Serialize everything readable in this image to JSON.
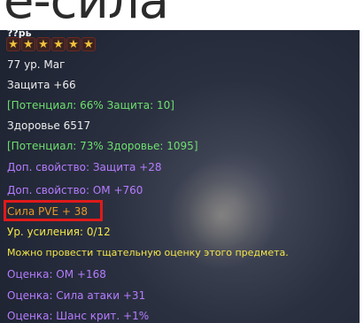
{
  "overlay_title": "е-сила",
  "tooltip": {
    "item_name": "??рь",
    "star_count": 6,
    "level_class": "77 ур.   Маг",
    "defense": "Защита +66",
    "defense_potential": "[Потенциал: 66% Защита: 10]",
    "health": "Здоровье 6517",
    "health_potential": "[Потенциал: 73% Здоровье: 1095]",
    "extra_defense": "Доп. свойство: Защита +28",
    "extra_om": "Доп. свойство: ОМ +760",
    "pve_power": "Сила PVE + 38",
    "enhance_level": "Ур. усиления: 0/12",
    "appraisal_hint": "Можно провести тщательную оценку этого предмета.",
    "rating_om": "Оценка:  ОМ +168",
    "rating_attack": "Оценка: Сила атаки +31",
    "rating_crit": "Оценка: Шанс крит. +1%"
  },
  "colors": {
    "white": "#ededed",
    "green": "#6ee06e",
    "purple": "#b67cff",
    "orange": "#e39a2a",
    "yellow": "#f4e64a",
    "highlight": "#e01a1a"
  },
  "icons": {
    "star": "star-icon"
  }
}
